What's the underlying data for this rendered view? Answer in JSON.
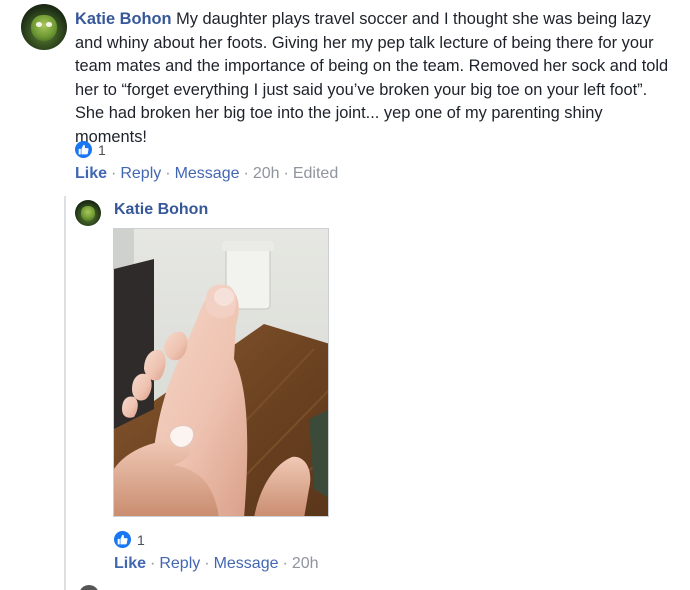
{
  "comment": {
    "author": "Katie Bohon",
    "text": "My daughter plays travel soccer and I thought she was being lazy and whiny about her foots. Giving her my pep talk lecture of being there for your team mates and the importance of being on the team. Removed her sock and told her to “forget everything I just said you’ve broken your big toe on your left foot”. She had broken her big toe into the joint... yep one of my parenting shiny moments!",
    "reaction_count": "1",
    "actions": {
      "like": "Like",
      "reply": "Reply",
      "message": "Message",
      "time": "20h",
      "edited": "Edited"
    }
  },
  "reply": {
    "author": "Katie Bohon",
    "reaction_count": "1",
    "actions": {
      "like": "Like",
      "reply": "Reply",
      "message": "Message",
      "time": "20h"
    }
  },
  "icons": {
    "like": "thumbs-up-icon",
    "avatar": "avatar-image"
  },
  "colors": {
    "link": "#365899",
    "action_link": "#4267b2",
    "meta": "#90949c",
    "like_badge": "#1877f2"
  }
}
